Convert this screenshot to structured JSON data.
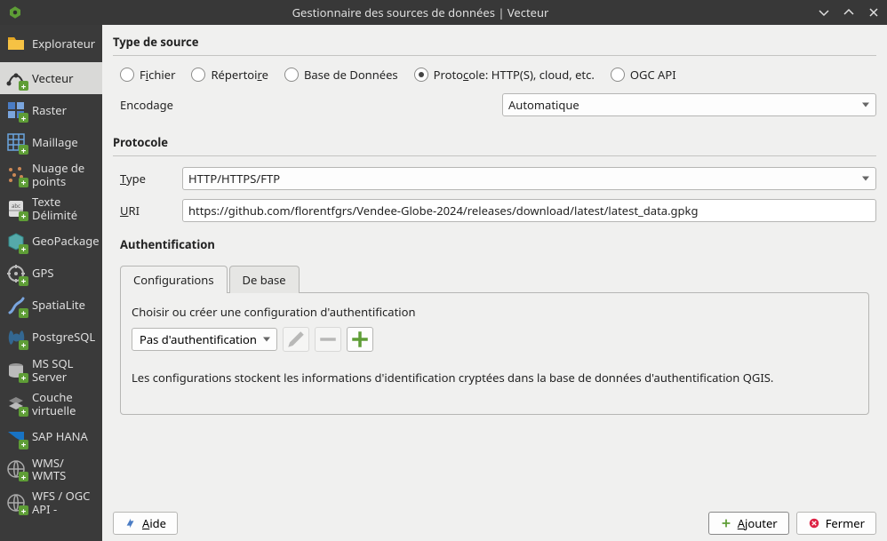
{
  "window": {
    "title": "Gestionnaire des sources de données | Vecteur"
  },
  "sidebar": {
    "items": [
      {
        "label": "Explorateur",
        "icon": "folder"
      },
      {
        "label": "Vecteur",
        "icon": "vector",
        "selected": true
      },
      {
        "label": "Raster",
        "icon": "raster"
      },
      {
        "label": "Maillage",
        "icon": "mesh"
      },
      {
        "label": "Nuage de points",
        "icon": "pointcloud"
      },
      {
        "label": "Texte Délimité",
        "icon": "csv"
      },
      {
        "label": "GeoPackage",
        "icon": "gpkg"
      },
      {
        "label": "GPS",
        "icon": "gps"
      },
      {
        "label": "SpatiaLite",
        "icon": "spatialite"
      },
      {
        "label": "PostgreSQL",
        "icon": "postgres"
      },
      {
        "label": "MS SQL Server",
        "icon": "mssql"
      },
      {
        "label": "Couche virtuelle",
        "icon": "virtual"
      },
      {
        "label": "SAP HANA",
        "icon": "saphana"
      },
      {
        "label": "WMS/\nWMTS",
        "icon": "wms"
      },
      {
        "label": "WFS / OGC API -",
        "icon": "wfs"
      }
    ]
  },
  "source_type": {
    "header": "Type de source",
    "options": {
      "file": "Fichier",
      "directory": "Répertoire",
      "database": "Base de Données",
      "protocol": "Protocole: HTTP(S), cloud, etc.",
      "ogcapi": "OGC API"
    },
    "selected": "protocol",
    "encoding_label": "Encodage",
    "encoding_value": "Automatique"
  },
  "protocol": {
    "header": "Protocole",
    "type_label": "Type",
    "type_value": "HTTP/HTTPS/FTP",
    "uri_label": "URI",
    "uri_value": "https://github.com/florentfgrs/Vendee-Globe-2024/releases/download/latest/latest_data.gpkg"
  },
  "auth": {
    "header": "Authentification",
    "tab_config": "Configurations",
    "tab_basic": "De base",
    "choose_text": "Choisir ou créer une configuration d'authentification",
    "select_value": "Pas d'authentification",
    "note": "Les configurations stockent les informations d'identification cryptées dans la base de données d'authentification QGIS."
  },
  "footer": {
    "help": "Aide",
    "add": "Ajouter",
    "close": "Fermer"
  }
}
